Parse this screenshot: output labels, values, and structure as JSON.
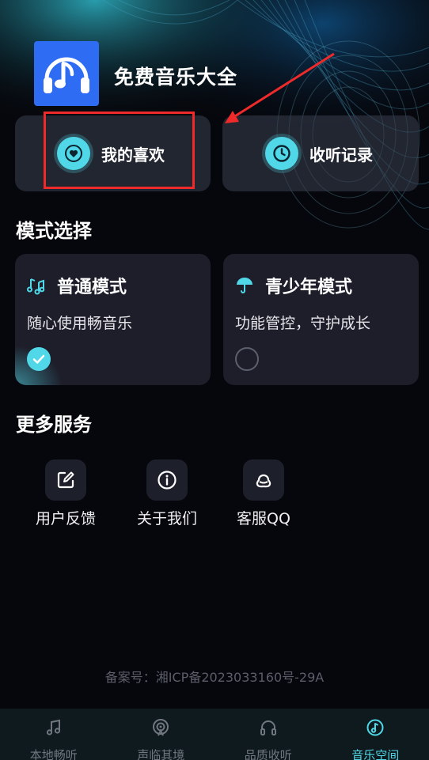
{
  "app": {
    "name": "免费音乐大全",
    "logo_icon": "music-note-headphones-icon",
    "brand_color": "#2f6cf4",
    "accent_color": "#51d8e8",
    "annotation_color": "#ee2a2a"
  },
  "quick_cards": {
    "favorites": {
      "label": "我的喜欢",
      "icon": "heart-icon"
    },
    "history": {
      "label": "收听记录",
      "icon": "clock-icon"
    }
  },
  "mode_section": {
    "title": "模式选择",
    "modes": [
      {
        "title": "普通模式",
        "description": "随心使用畅音乐",
        "icon": "music-notes-icon",
        "selected": true
      },
      {
        "title": "青少年模式",
        "description": "功能管控，守护成长",
        "icon": "umbrella-icon",
        "selected": false
      }
    ]
  },
  "more_section": {
    "title": "更多服务",
    "services": [
      {
        "label": "用户反馈",
        "icon": "edit-icon"
      },
      {
        "label": "关于我们",
        "icon": "info-icon"
      },
      {
        "label": "客服QQ",
        "icon": "qq-icon"
      }
    ]
  },
  "footer": {
    "icp": "备案号：湘ICP备2023033160号-29A"
  },
  "bottom_nav": {
    "items": [
      {
        "label": "本地畅听",
        "icon": "music-note-icon",
        "active": false
      },
      {
        "label": "声临其境",
        "icon": "podcast-icon",
        "active": false
      },
      {
        "label": "品质收听",
        "icon": "headphones-icon",
        "active": false
      },
      {
        "label": "音乐空间",
        "icon": "music-disc-icon",
        "active": true
      }
    ]
  }
}
